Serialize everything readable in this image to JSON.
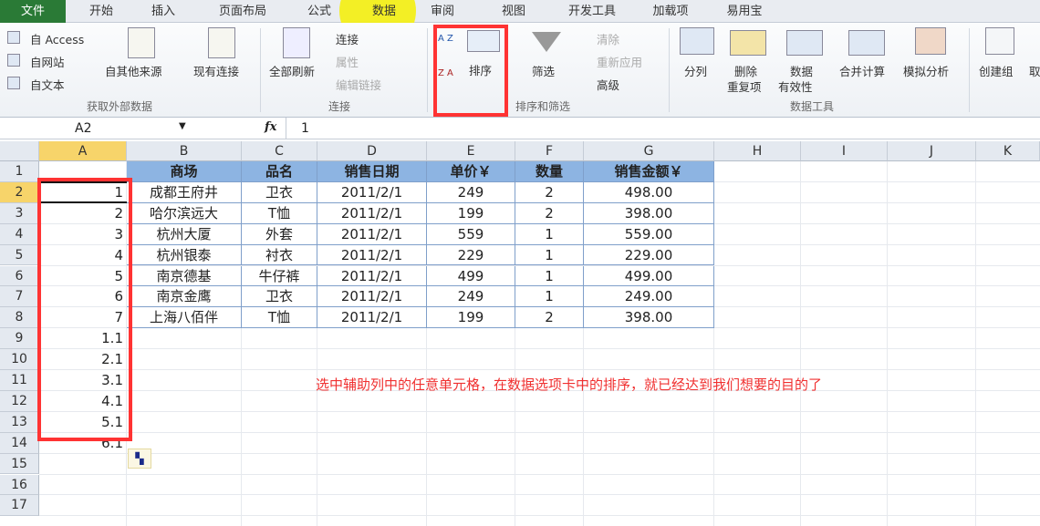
{
  "tabs": [
    "文件",
    "开始",
    "插入",
    "页面布局",
    "公式",
    "数据",
    "审阅",
    "视图",
    "开发工具",
    "加载项",
    "易用宝"
  ],
  "ribbon": {
    "get_external": {
      "access": "自 Access",
      "web": "自网站",
      "text": "自文本",
      "other": "自其他来源",
      "existing": "现有连接",
      "group": "获取外部数据"
    },
    "connections": {
      "refresh_all": "全部刷新",
      "connections": "连接",
      "properties": "属性",
      "edit_links": "编辑链接",
      "group": "连接"
    },
    "sort_filter": {
      "sort": "排序",
      "filter": "筛选",
      "clear": "清除",
      "reapply": "重新应用",
      "advanced": "高级",
      "group": "排序和筛选",
      "sort_az": "A Z",
      "sort_za": "Z A"
    },
    "data_tools": {
      "text_to_columns": "分列",
      "remove_dup_1": "删除",
      "remove_dup_2": "重复项",
      "validation_1": "数据",
      "validation_2": "有效性",
      "consolidate": "合并计算",
      "what_if": "模拟分析",
      "group": "数据工具"
    },
    "outline": {
      "group_btn": "创建组",
      "ungroup": "取"
    }
  },
  "formula_bar": {
    "name_box": "A2",
    "fx": "fx",
    "value": "1"
  },
  "columns": [
    "A",
    "B",
    "C",
    "D",
    "E",
    "F",
    "G",
    "H",
    "I",
    "J",
    "K"
  ],
  "rows": [
    "1",
    "2",
    "3",
    "4",
    "5",
    "6",
    "7",
    "8",
    "9",
    "10",
    "11",
    "12",
    "13",
    "14",
    "15",
    "16",
    "17"
  ],
  "table": {
    "headers": [
      "商场",
      "品名",
      "销售日期",
      "单价￥",
      "数量",
      "销售金额￥"
    ],
    "data": [
      [
        "成都王府井",
        "卫衣",
        "2011/2/1",
        "249",
        "2",
        "498.00"
      ],
      [
        "哈尔滨远大",
        "T恤",
        "2011/2/1",
        "199",
        "2",
        "398.00"
      ],
      [
        "杭州大厦",
        "外套",
        "2011/2/1",
        "559",
        "1",
        "559.00"
      ],
      [
        "杭州银泰",
        "衬衣",
        "2011/2/1",
        "229",
        "1",
        "229.00"
      ],
      [
        "南京德基",
        "牛仔裤",
        "2011/2/1",
        "499",
        "1",
        "499.00"
      ],
      [
        "南京金鹰",
        "卫衣",
        "2011/2/1",
        "249",
        "1",
        "249.00"
      ],
      [
        "上海八佰伴",
        "T恤",
        "2011/2/1",
        "199",
        "2",
        "398.00"
      ]
    ]
  },
  "helper_column": [
    "1",
    "2",
    "3",
    "4",
    "5",
    "6",
    "7",
    "1.1",
    "2.1",
    "3.1",
    "4.1",
    "5.1",
    "6.1"
  ],
  "note": "选中辅助列中的任意单元格，在数据选项卡中的排序，就已经达到我们想要的目的了",
  "colors": {
    "accent": "#2a7a36",
    "highlight": "#f4f00e",
    "annotation": "#f03030",
    "table_header": "#8db4e2"
  }
}
